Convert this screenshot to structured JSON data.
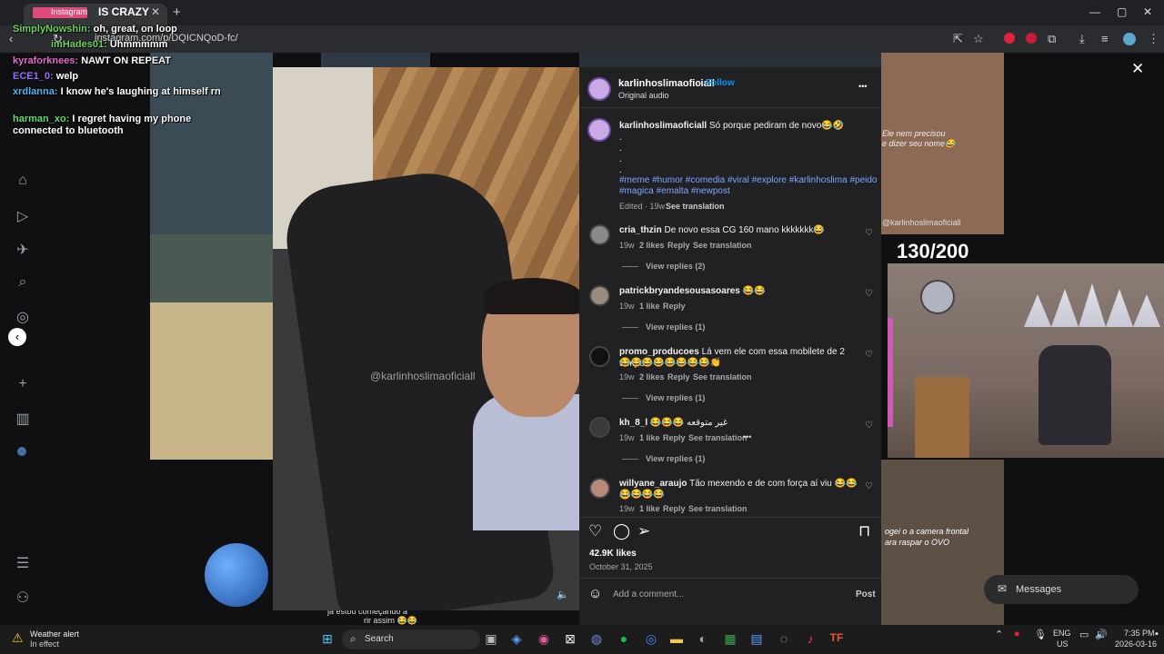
{
  "browser": {
    "tab_title": "IS CRAZY",
    "tab_overlay": "Instagram",
    "url": "instagram.com/p/DQICNQoD-fc/",
    "new_tab": "+",
    "close": "✕",
    "minimize": "—",
    "maximize": "▢",
    "win_close": "✕"
  },
  "chat": [
    {
      "name": "SimplyNowshin:",
      "msg": "oh, great, on loop",
      "color": "#6bd45b"
    },
    {
      "name": "imHades01:",
      "msg": "Uhmmmmm",
      "color": "#6bd45b"
    },
    {
      "name": "kyraforknees:",
      "msg": "NAWT ON REPEAT",
      "color": "#e46bd2"
    },
    {
      "name": "ECE1_0:",
      "msg": "welp",
      "color": "#9d6bff"
    },
    {
      "name": "xrdlanna:",
      "msg": "I know he's laughing at himself rn",
      "color": "#4fb4f0"
    },
    {
      "name": "harman_xo:",
      "msg": "I regret having my phone connected to bluetooth",
      "color": "#5be06b"
    }
  ],
  "video": {
    "watermark": "@karlinhoslimaoficiall",
    "mute_icon": "speaker-icon"
  },
  "post": {
    "author": "karlinhoslimaoficiall",
    "follow": "Follow",
    "separator": "•",
    "audio": "Original audio",
    "more": "•••",
    "caption": "Só porque pediram de novo😂🤣",
    "dots": [
      ".",
      ".",
      ".",
      "."
    ],
    "hashtags_line1": "#meme #humor #comedia #viral #explore #karlinhoslima #peido",
    "hashtags_line2": "#magica #emalta #newpost",
    "edited": "Edited · 19w",
    "see_translation": "See translation",
    "likes": "42.9K likes",
    "date": "October 31, 2025",
    "add_comment": "Add a comment...",
    "post_button": "Post"
  },
  "comments": [
    {
      "user": "cria_thzin",
      "text": "De novo essa CG 160 mano kkkkkkk😂",
      "age": "19w",
      "likes": "2 likes",
      "reply": "Reply",
      "translate": "See translation",
      "replies": "View replies (2)"
    },
    {
      "user": "patrickbryandesousasoares",
      "text": "😂😂",
      "age": "19w",
      "likes": "1 like",
      "reply": "Reply",
      "translate": "",
      "replies": "View replies (1)"
    },
    {
      "user": "promo_producoes",
      "text": "Lá vem ele com essa mobilete de 2 tempos",
      "text2": "😂😂😂😂😂😂😂😂👏",
      "age": "19w",
      "likes": "2 likes",
      "reply": "Reply",
      "translate": "See translation",
      "replies": "View replies (1)"
    },
    {
      "user": "kh_8_l",
      "text": "😂😂😂 غير متوقعه",
      "age": "19w",
      "likes": "1 like",
      "reply": "Reply",
      "translate": "See translation",
      "more": "•••",
      "replies": "View replies (1)"
    },
    {
      "user": "willyane_araujo",
      "text": "Tão mexendo e de com força aí viu 😂😂😂",
      "text2": "😂😂😂😂",
      "age": "19w",
      "likes": "1 like",
      "reply": "Reply",
      "translate": "See translation"
    }
  ],
  "background": {
    "counter": "130/200",
    "side_text_1": "Ele nem precisou",
    "side_text_2": "e dizer seu nome😂",
    "side_handle": "@karlinhoslimaoficiall",
    "bottom_text_1": "ogei o a camera frontal",
    "bottom_text_2": "ara raspar o OVO",
    "messages": "Messages",
    "overlay_text_1": "ja estou começando a",
    "overlay_text_2": "rir assim 😂😂"
  },
  "taskbar": {
    "weather_title": "Weather alert",
    "weather_sub": "In effect",
    "search": "Search",
    "lang1": "ENG",
    "lang2": "US",
    "time": "7:35 PM",
    "date": "2026-03-16"
  },
  "colors": {
    "accent": "#0095f6",
    "panel": "#212124",
    "link": "#7aa7ff"
  }
}
